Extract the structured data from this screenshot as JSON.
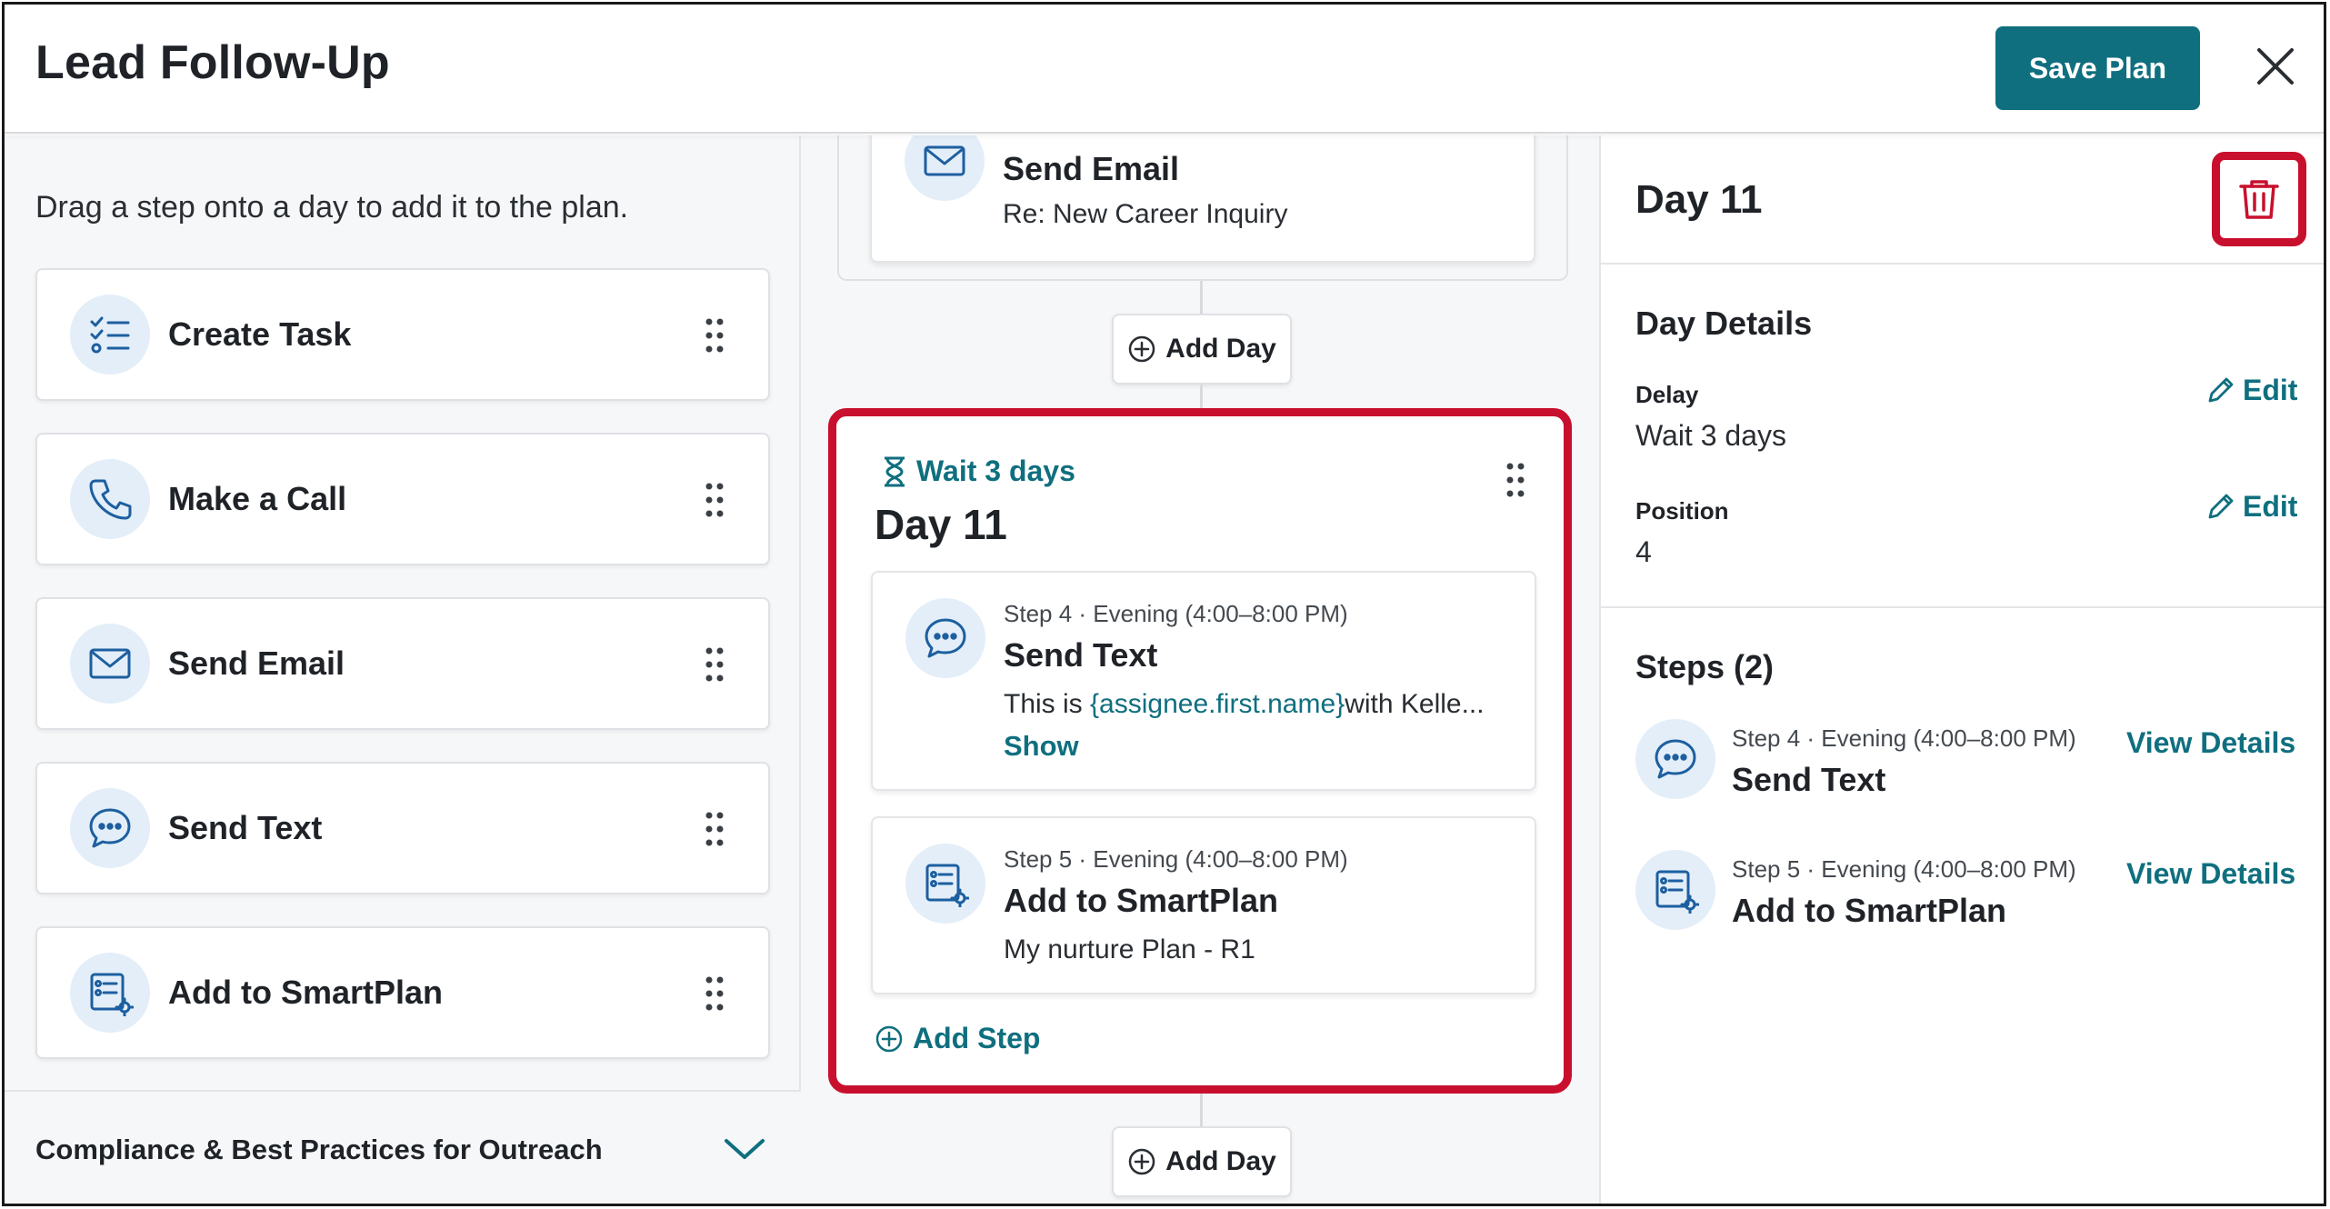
{
  "header": {
    "title": "Lead Follow-Up",
    "save_label": "Save Plan"
  },
  "palette": {
    "hint": "Drag a step onto a day to add it to the plan.",
    "items": [
      {
        "label": "Create Task",
        "icon": "task-list-icon"
      },
      {
        "label": "Make a Call",
        "icon": "phone-icon"
      },
      {
        "label": "Send Email",
        "icon": "envelope-icon"
      },
      {
        "label": "Send Text",
        "icon": "chat-bubble-icon"
      },
      {
        "label": "Add to SmartPlan",
        "icon": "smartplan-icon"
      }
    ],
    "compliance_label": "Compliance & Best Practices for Outreach"
  },
  "timeline": {
    "prev_step": {
      "name": "Send Email",
      "desc": "Re: New Career Inquiry"
    },
    "add_day_label": "Add Day",
    "day": {
      "wait": "Wait 3 days",
      "title": "Day 11",
      "steps": [
        {
          "meta": "Step 4 · Evening (4:00–8:00 PM)",
          "name": "Send Text",
          "desc_prefix": "This is ",
          "desc_token": "{assignee.first.name}",
          "desc_suffix": "with Kelle...",
          "show_label": "Show"
        },
        {
          "meta": "Step 5 · Evening (4:00–8:00 PM)",
          "name": "Add to SmartPlan",
          "desc": "My nurture Plan - R1"
        }
      ],
      "add_step_label": "Add Step"
    }
  },
  "details": {
    "title": "Day 11",
    "section_title": "Day Details",
    "delay_label": "Delay",
    "delay_value": "Wait 3 days",
    "position_label": "Position",
    "position_value": "4",
    "edit_label": "Edit",
    "steps_title": "Steps (2)",
    "steps": [
      {
        "meta": "Step 4 · Evening (4:00–8:00 PM)",
        "name": "Send Text",
        "link": "View Details"
      },
      {
        "meta": "Step 5 · Evening (4:00–8:00 PM)",
        "name": "Add to SmartPlan",
        "link": "View Details"
      }
    ]
  },
  "colors": {
    "accent": "#0f6f7f",
    "highlight": "#c8102e",
    "icon_bg": "#e3eef8",
    "icon_stroke": "#1d5fa0"
  }
}
